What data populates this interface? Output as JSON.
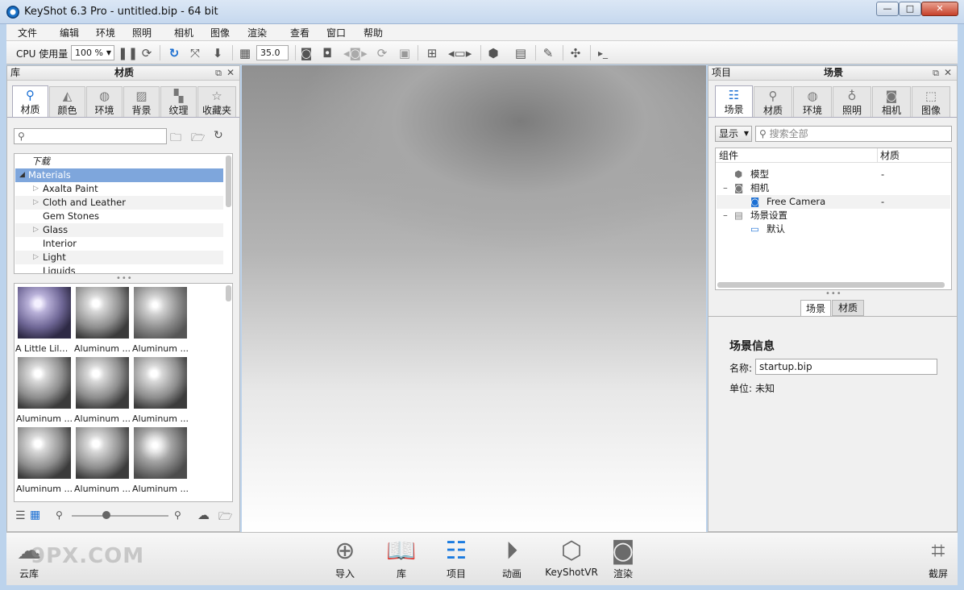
{
  "window": {
    "title": "KeyShot 6.3 Pro  - untitled.bip  - 64 bit",
    "min": "—",
    "max": "□",
    "close": "✕"
  },
  "menu": [
    "文件",
    "编辑",
    "环境",
    "照明",
    "相机",
    "图像",
    "渲染",
    "查看",
    "窗口",
    "帮助"
  ],
  "toolbar": {
    "cpu_label": "CPU 使用量",
    "cpu_value": "100 %",
    "fov_value": "35.0"
  },
  "library": {
    "header_left": "库",
    "title": "材质",
    "tabs": [
      "材质",
      "颜色",
      "环境",
      "背景",
      "纹理",
      "收藏夹"
    ],
    "search_placeholder": "",
    "tree": [
      "下载",
      "Materials",
      "Axalta Paint",
      "Cloth and Leather",
      "Gem Stones",
      "Glass",
      "Interior",
      "Light",
      "Liquids"
    ],
    "thumbs": [
      "A Little Lilac...",
      "Aluminum ...",
      "Aluminum ...",
      "Aluminum ...",
      "Aluminum ...",
      "Aluminum ...",
      "Aluminum ...",
      "Aluminum ...",
      "Aluminum ..."
    ]
  },
  "project": {
    "header_left": "项目",
    "title": "场景",
    "tabs": [
      "场景",
      "材质",
      "环境",
      "照明",
      "相机",
      "图像"
    ],
    "show_label": "显示",
    "search_placeholder": "搜索全部",
    "col_component": "组件",
    "col_material": "材质",
    "tree": [
      {
        "label": "模型",
        "material": "-"
      },
      {
        "label": "相机",
        "material": ""
      },
      {
        "label": "Free Camera",
        "material": "-"
      },
      {
        "label": "场景设置",
        "material": ""
      },
      {
        "label": "默认",
        "material": ""
      }
    ],
    "subtabs": [
      "场景",
      "材质"
    ],
    "info_title": "场景信息",
    "name_label": "名称:",
    "name_value": "startup.bip",
    "unit_label": "单位:",
    "unit_value": "未知"
  },
  "bottom": {
    "cloud": "云库",
    "import": "导入",
    "library": "库",
    "project": "项目",
    "animation": "动画",
    "keyshotvr": "KeyShotVR",
    "render": "渲染",
    "screenshot": "截屏"
  },
  "watermark": "9PX.COM"
}
